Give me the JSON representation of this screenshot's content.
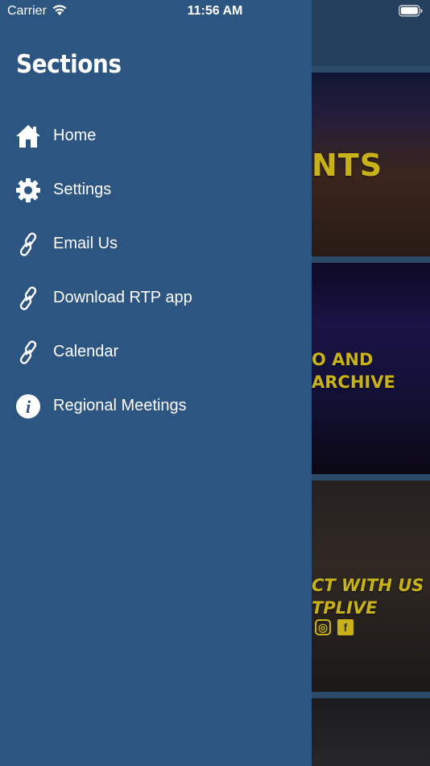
{
  "status_bar": {
    "carrier": "Carrier",
    "time": "11:56 AM"
  },
  "drawer": {
    "title": "Sections",
    "items": [
      {
        "label": "Home",
        "icon": "home-icon"
      },
      {
        "label": "Settings",
        "icon": "gear-icon"
      },
      {
        "label": "Email Us",
        "icon": "link-icon"
      },
      {
        "label": "Download RTP app",
        "icon": "link-icon"
      },
      {
        "label": "Calendar",
        "icon": "link-icon"
      },
      {
        "label": "Regional Meetings",
        "icon": "info-icon"
      }
    ]
  },
  "background": {
    "card1_text": "NTS",
    "card2_text_line1": "O AND",
    "card2_text_line2": "ARCHIVE",
    "card3_text_line1": "CT WITH US",
    "card3_text_line2": "TPLIVE"
  },
  "colors": {
    "drawer_background": "#2c5582",
    "card_text": "#c8b21a"
  }
}
